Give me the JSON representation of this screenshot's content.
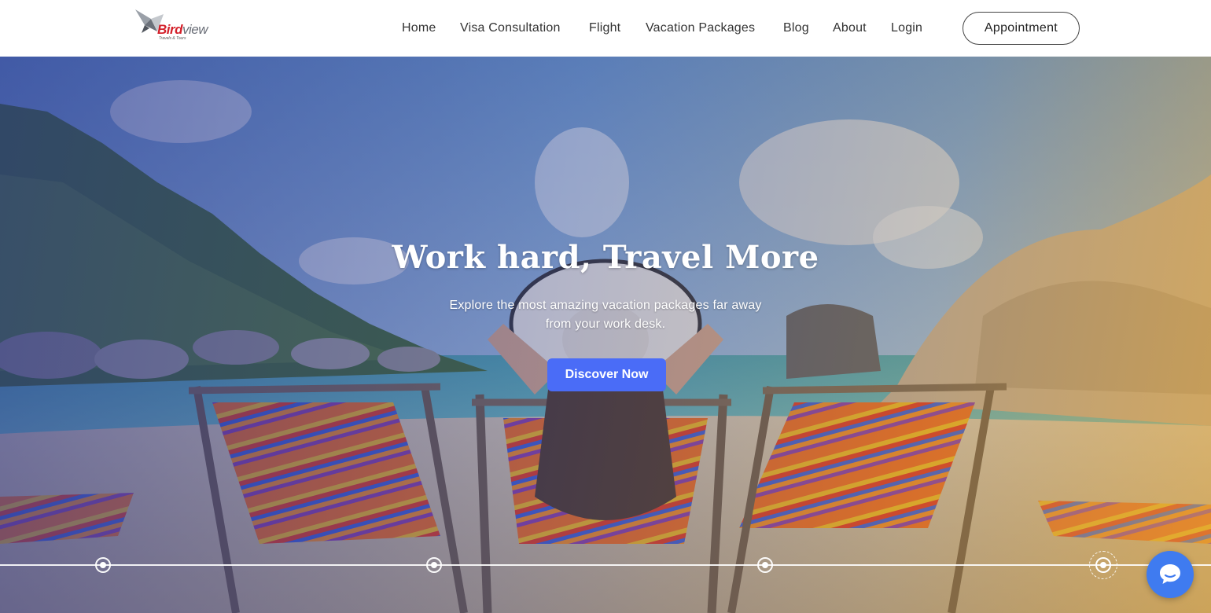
{
  "brand": {
    "name_part1": "Bird",
    "name_part2": "view",
    "tagline": "Travels & Tours"
  },
  "nav": {
    "items": [
      {
        "label": "Home"
      },
      {
        "label": "Visa Consultation"
      },
      {
        "label": "Flight"
      },
      {
        "label": "Vacation Packages"
      },
      {
        "label": "Blog"
      },
      {
        "label": "About"
      },
      {
        "label": "Login"
      }
    ],
    "appointment_label": "Appointment"
  },
  "hero": {
    "title": "Work hard, Travel More",
    "subtitle": "Explore the most amazing vacation packages far away from your work desk.",
    "cta_label": "Discover Now",
    "slide_count": 4,
    "active_slide": 4
  },
  "chat": {
    "icon": "chat-bubble-icon"
  },
  "colors": {
    "accent": "#4a6cf7",
    "chat": "#3f7bf0",
    "brand_red": "#d3202a"
  }
}
